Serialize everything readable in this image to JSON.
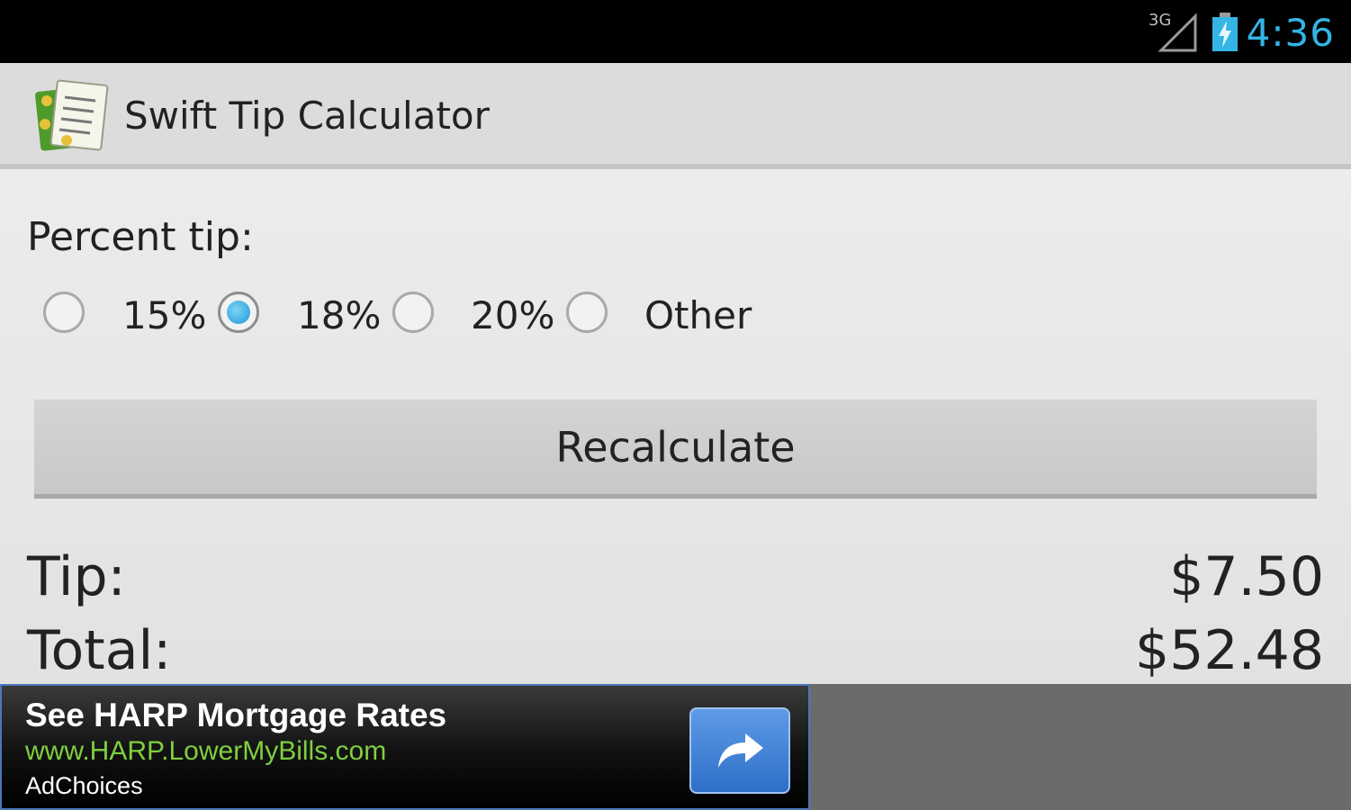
{
  "status_bar": {
    "network": "3G",
    "time": "4:36",
    "time_color": "#33b5e5"
  },
  "action_bar": {
    "title": "Swift Tip Calculator",
    "icon": "receipt-app-icon"
  },
  "tip_form": {
    "percent_label": "Percent tip:",
    "options": [
      {
        "label": "15%",
        "selected": false
      },
      {
        "label": "18%",
        "selected": true
      },
      {
        "label": "20%",
        "selected": false
      },
      {
        "label": "Other",
        "selected": false
      }
    ],
    "recalculate_label": "Recalculate"
  },
  "results": {
    "tip_label": "Tip:",
    "tip_value": "$7.50",
    "total_label": "Total:",
    "total_value": "$52.48"
  },
  "ad": {
    "title": "See HARP Mortgage Rates",
    "url": "www.HARP.LowerMyBills.com",
    "choices": "AdChoices",
    "icon": "share-arrow-icon",
    "url_color": "#7fcf3f",
    "button_color": "#2d6fc9"
  }
}
